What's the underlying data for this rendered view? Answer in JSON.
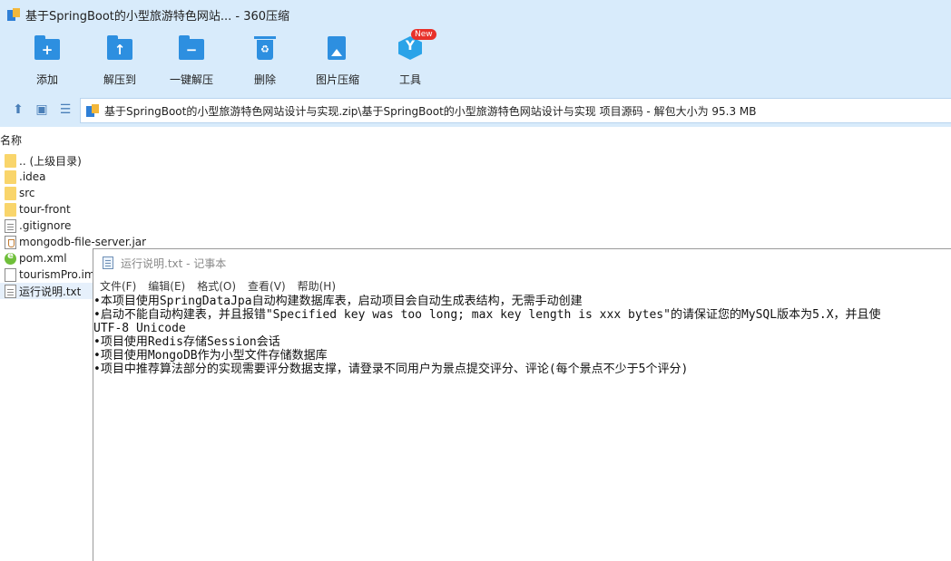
{
  "window": {
    "title": "基于SpringBoot的小型旅游特色网站... - 360压缩"
  },
  "toolbar": {
    "add": "添加",
    "extract_to": "解压到",
    "one_click_extract": "一键解压",
    "delete": "删除",
    "image_compress": "图片压缩",
    "tools": "工具",
    "new_badge": "New",
    "accent": "#2d8fe0"
  },
  "address": {
    "path": "基于SpringBoot的小型旅游特色网站设计与实现.zip\\基于SpringBoot的小型旅游特色网站设计与实现 项目源码 - 解包大小为 95.3 MB"
  },
  "file_list": {
    "header_name": "名称",
    "items": [
      {
        "name": ".. (上级目录)",
        "type": "folder"
      },
      {
        "name": ".idea",
        "type": "folder"
      },
      {
        "name": "src",
        "type": "folder"
      },
      {
        "name": "tour-front",
        "type": "folder"
      },
      {
        "name": ".gitignore",
        "type": "text"
      },
      {
        "name": "mongodb-file-server.jar",
        "type": "jar"
      },
      {
        "name": "pom.xml",
        "type": "xml"
      },
      {
        "name": "tourismPro.im",
        "type": "doc"
      },
      {
        "name": "运行说明.txt",
        "type": "text"
      }
    ]
  },
  "notepad": {
    "title": "运行说明.txt - 记事本",
    "menus": [
      "文件(F)",
      "编辑(E)",
      "格式(O)",
      "查看(V)",
      "帮助(H)"
    ],
    "lines": [
      "•本项目使用SpringDataJpa自动构建数据库表，启动项目会自动生成表结构，无需手动创建",
      "•启动不能自动构建表，并且报错\"Specified key was too long; max key length is xxx bytes\"的请保证您的MySQL版本为5.X，并且使",
      "UTF-8 Unicode",
      "•项目使用Redis存储Session会话",
      "•项目使用MongoDB作为小型文件存储数据库",
      "•项目中推荐算法部分的实现需要评分数据支撑，请登录不同用户为景点提交评分、评论(每个景点不少于5个评分)"
    ]
  }
}
